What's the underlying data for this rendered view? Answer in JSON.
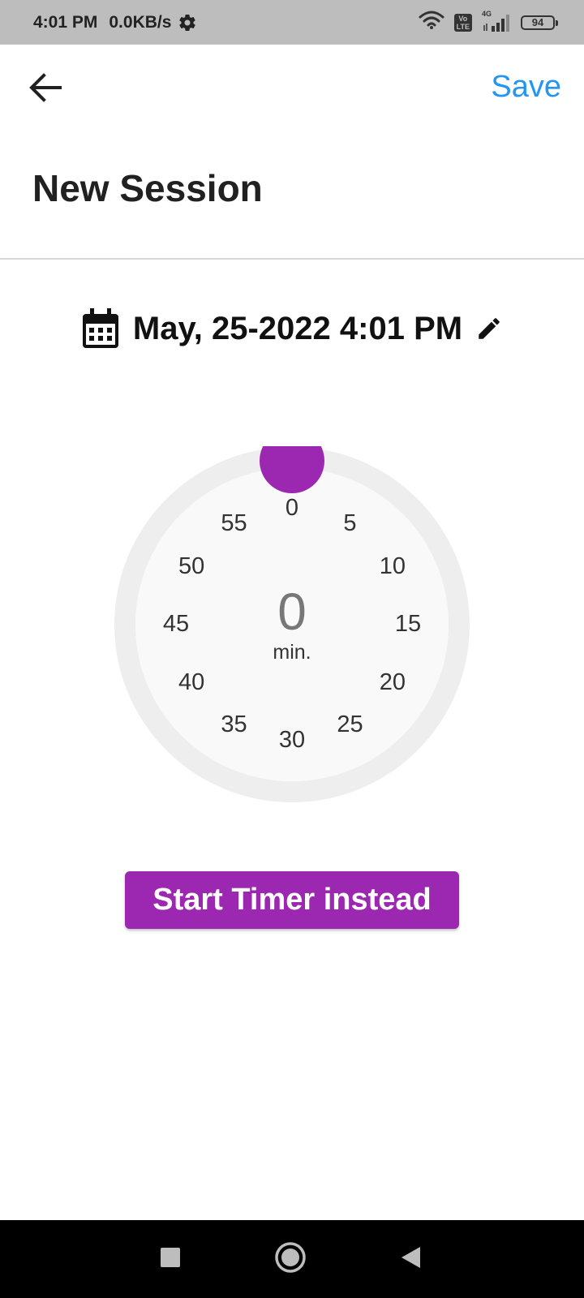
{
  "status_bar": {
    "time": "4:01 PM",
    "speed": "0.0KB/s",
    "volte_label": "Vo\nLTE",
    "network_type": "4G",
    "battery": "94"
  },
  "app_bar": {
    "save_label": "Save"
  },
  "page": {
    "title": "New Session"
  },
  "session": {
    "datetime": "May, 25-2022 4:01 PM"
  },
  "dial": {
    "value": "0",
    "unit": "min.",
    "ticks": [
      "0",
      "5",
      "10",
      "15",
      "20",
      "25",
      "30",
      "35",
      "40",
      "45",
      "50",
      "55"
    ],
    "selected_minutes": 0,
    "knob_color": "#9c27b0",
    "track_color": "#eeeeee",
    "face_color": "#f9f9f9"
  },
  "actions": {
    "start_timer_label": "Start Timer instead"
  },
  "icons": {
    "back": "arrow-left-icon",
    "calendar": "calendar-icon",
    "edit": "pencil-icon",
    "nav_recents": "square-icon",
    "nav_home": "circle-icon",
    "nav_back": "triangle-back-icon"
  },
  "colors": {
    "accent": "#9c27b0",
    "link": "#2196f3",
    "status_bar_bg": "#bdbdbd"
  }
}
